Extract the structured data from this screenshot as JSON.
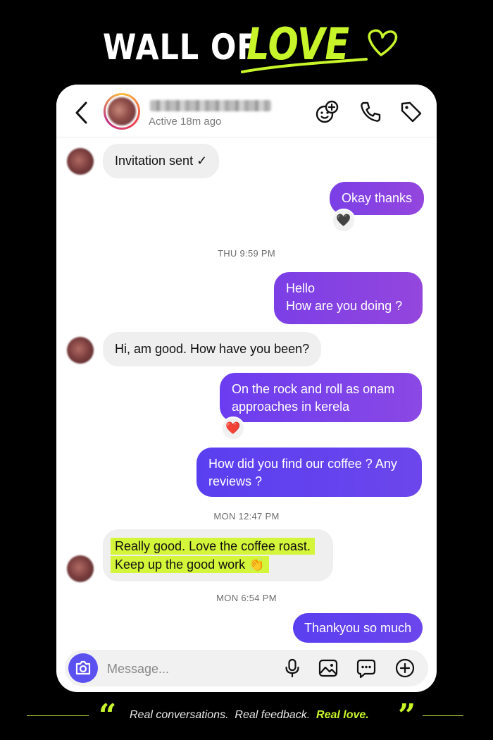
{
  "header": {
    "title_part1": "WALL OF",
    "title_part2": "LOVE",
    "accent_color": "#c8f52a"
  },
  "conversation": {
    "status": "Active 18m ago",
    "icons": [
      "back-chevron-icon",
      "sticker-add-icon",
      "phone-icon",
      "tag-icon"
    ],
    "messages": [
      {
        "side": "incoming",
        "text": "Invitation sent ✓"
      },
      {
        "side": "outgoing",
        "text": "Okay thanks",
        "reaction": "🖤"
      },
      {
        "type": "timestamp",
        "text": "THU 9:59 PM"
      },
      {
        "side": "outgoing",
        "line1": "Hello",
        "line2": "How are you doing ?"
      },
      {
        "side": "incoming",
        "text": "Hi, am good. How have you been?"
      },
      {
        "side": "outgoing",
        "line1": "On the rock and roll as onam",
        "line2": "approaches in kerela",
        "reaction": "❤️"
      },
      {
        "side": "outgoing",
        "line1": "How did you find our coffee ? Any",
        "line2": "reviews ?"
      },
      {
        "type": "timestamp",
        "text": "MON 12:47 PM"
      },
      {
        "side": "incoming",
        "highlighted": true,
        "line1": "Really good. Love the coffee roast.",
        "line2": "Keep up the good work 👏"
      },
      {
        "type": "timestamp",
        "text": "MON 6:54 PM"
      },
      {
        "side": "outgoing",
        "text": "Thankyou so much"
      }
    ]
  },
  "composer": {
    "placeholder": "Message...",
    "icons": [
      "camera-icon",
      "microphone-icon",
      "gallery-icon",
      "chat-more-icon",
      "plus-circle-icon"
    ]
  },
  "footer": {
    "part1": "Real conversations.",
    "part2": "Real feedback.",
    "part3": "Real love."
  }
}
